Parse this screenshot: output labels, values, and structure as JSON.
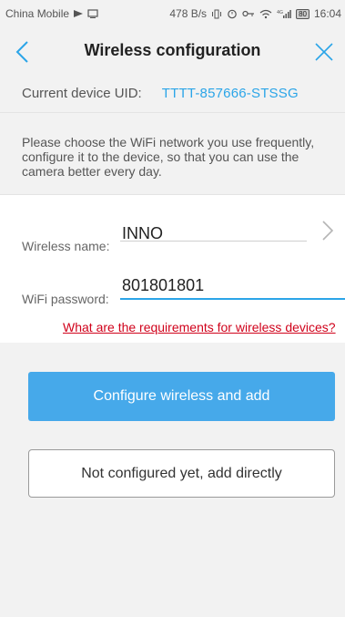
{
  "status_bar": {
    "carrier": "China Mobile",
    "speed": "478 B/s",
    "network": "4G",
    "battery": "80",
    "time": "16:04"
  },
  "nav": {
    "title": "Wireless configuration"
  },
  "device": {
    "uid_label": "Current device UID:",
    "uid_value": "TTTT-857666-STSSG"
  },
  "description": "Please choose the WiFi network you use frequently, configure it to the device, so that you can use the camera better every day.",
  "form": {
    "wireless_name_label": "Wireless name:",
    "wireless_name_value": "INNO",
    "password_label": "WiFi password:",
    "password_value": "801801801",
    "requirements_link": "What are the requirements for wireless devices?"
  },
  "buttons": {
    "configure": "Configure wireless and add",
    "add_directly": "Not configured yet, add directly"
  },
  "colors": {
    "accent": "#2ba5e8",
    "primary_button": "#46a9ea",
    "link_red": "#d0021b"
  }
}
